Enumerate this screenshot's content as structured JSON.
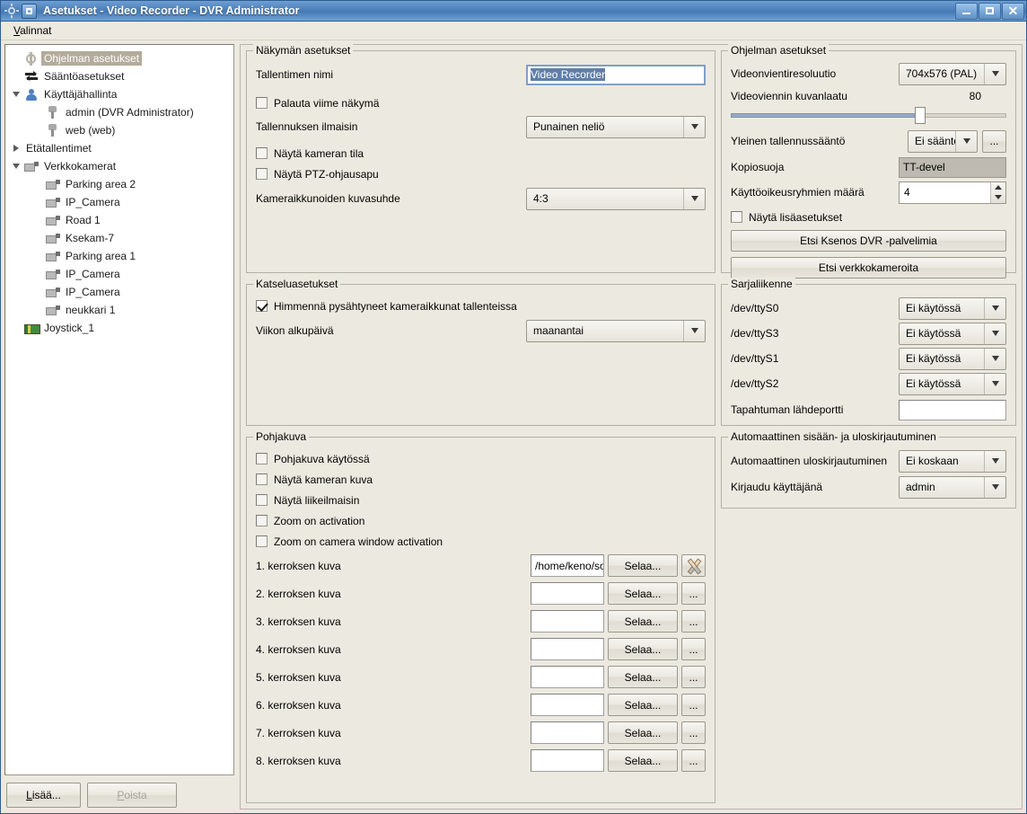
{
  "window": {
    "title": "Asetukset - Video Recorder - DVR Administrator",
    "minimize_label": "_",
    "maximize_label": "□",
    "close_label": "✕"
  },
  "menubar": {
    "items": [
      {
        "label": "Valinnat",
        "mnemonic": "V"
      }
    ]
  },
  "tree": {
    "items": [
      {
        "label": "Ohjelman asetukset",
        "icon": "gear-icon",
        "indent": 1,
        "selected": true,
        "twisty": "none"
      },
      {
        "label": "Sääntöasetukset",
        "icon": "rules-icon",
        "indent": 1,
        "selected": false,
        "twisty": "none"
      },
      {
        "label": "Käyttäjähallinta",
        "icon": "user-icon",
        "indent": 1,
        "selected": false,
        "twisty": "down"
      },
      {
        "label": "admin (DVR Administrator)",
        "icon": "key-icon",
        "indent": 2,
        "selected": false,
        "twisty": "none"
      },
      {
        "label": "web (web)",
        "icon": "key-icon",
        "indent": 2,
        "selected": false,
        "twisty": "none"
      },
      {
        "label": "Etätallentimet",
        "icon": "none",
        "indent": 1,
        "selected": false,
        "twisty": "right"
      },
      {
        "label": "Verkkokamerat",
        "icon": "camera-icon",
        "indent": 1,
        "selected": false,
        "twisty": "down"
      },
      {
        "label": "Parking area 2",
        "icon": "camera-icon",
        "indent": 2,
        "selected": false,
        "twisty": "none"
      },
      {
        "label": "IP_Camera",
        "icon": "camera-icon",
        "indent": 2,
        "selected": false,
        "twisty": "none"
      },
      {
        "label": "Road 1",
        "icon": "camera-icon",
        "indent": 2,
        "selected": false,
        "twisty": "none"
      },
      {
        "label": "Ksekam-7",
        "icon": "camera-icon",
        "indent": 2,
        "selected": false,
        "twisty": "none"
      },
      {
        "label": "Parking area 1",
        "icon": "camera-icon",
        "indent": 2,
        "selected": false,
        "twisty": "none"
      },
      {
        "label": "IP_Camera",
        "icon": "camera-icon",
        "indent": 2,
        "selected": false,
        "twisty": "none"
      },
      {
        "label": "IP_Camera",
        "icon": "camera-icon",
        "indent": 2,
        "selected": false,
        "twisty": "none"
      },
      {
        "label": "neukkari 1",
        "icon": "camera-icon",
        "indent": 2,
        "selected": false,
        "twisty": "none"
      },
      {
        "label": "Joystick_1",
        "icon": "joystick-icon",
        "indent": 1,
        "selected": false,
        "twisty": "none"
      }
    ],
    "add_button": {
      "label": "Lisää...",
      "mnemonic": "L",
      "enabled": true
    },
    "delete_button": {
      "label": "Poista",
      "mnemonic": "P",
      "enabled": false
    }
  },
  "view_settings": {
    "title": "Näkymän asetukset",
    "recorder_name_label": "Tallentimen nimi",
    "recorder_name_value": "Video Recorder",
    "restore_last_view_label": "Palauta viime näkymä",
    "restore_last_view_checked": false,
    "recording_indicator_label": "Tallennuksen ilmaisin",
    "recording_indicator_value": "Punainen neliö",
    "show_camera_state_label": "Näytä kameran tila",
    "show_camera_state_checked": false,
    "show_ptz_help_label": "Näytä PTZ-ohjausapu",
    "show_ptz_help_checked": false,
    "aspect_ratio_label": "Kameraikkunoiden kuvasuhde",
    "aspect_ratio_value": "4:3"
  },
  "program_settings": {
    "title": "Ohjelman asetukset",
    "export_resolution_label": "Videonvientiresoluutio",
    "export_resolution_value": "704x576 (PAL)",
    "export_quality_label": "Videoviennin kuvanlaatu",
    "export_quality_value": "80",
    "export_quality_percent": 80,
    "general_rule_label": "Yleinen tallennussääntö",
    "general_rule_value": "Ei sääntöä",
    "general_rule_more": "...",
    "copy_protection_label": "Kopiosuoja",
    "copy_protection_value": "TT-devel",
    "permission_groups_label": "Käyttöoikeusryhmien määrä",
    "permission_groups_value": "4",
    "show_advanced_label": "Näytä lisäasetukset",
    "show_advanced_checked": false,
    "find_servers_button": "Etsi Ksenos DVR -palvelimia",
    "find_cameras_button": "Etsi verkkokameroita"
  },
  "viewing_settings": {
    "title": "Katseluasetukset",
    "dim_stopped_label": "Himmennä pysähtyneet kameraikkunat tallenteissa",
    "dim_stopped_checked": true,
    "week_start_label": "Viikon alkupäivä",
    "week_start_value": "maanantai"
  },
  "serial": {
    "title": "Sarjaliikenne",
    "ports": [
      {
        "label": "/dev/ttyS0",
        "value": "Ei käytössä"
      },
      {
        "label": "/dev/ttyS3",
        "value": "Ei käytössä"
      },
      {
        "label": "/dev/ttyS1",
        "value": "Ei käytössä"
      },
      {
        "label": "/dev/ttyS2",
        "value": "Ei käytössä"
      }
    ],
    "event_source_label": "Tapahtuman lähdeportti",
    "event_source_value": ""
  },
  "floorplan": {
    "title": "Pohjakuva",
    "checkboxes": [
      {
        "label": "Pohjakuva käytössä",
        "checked": false
      },
      {
        "label": "Näytä kameran kuva",
        "checked": false
      },
      {
        "label": "Näytä liikeilmaisin",
        "checked": false
      },
      {
        "label": "Zoom on activation",
        "checked": false
      },
      {
        "label": "Zoom on camera window activation",
        "checked": false
      }
    ],
    "browse_label": "Selaa...",
    "dots_label": "...",
    "floors": [
      {
        "label": "1. kerroksen kuva",
        "value": "/home/keno/sot",
        "extra": "clear-icon"
      },
      {
        "label": "2. kerroksen kuva",
        "value": "",
        "extra": "dots"
      },
      {
        "label": "3. kerroksen kuva",
        "value": "",
        "extra": "dots"
      },
      {
        "label": "4. kerroksen kuva",
        "value": "",
        "extra": "dots"
      },
      {
        "label": "5. kerroksen kuva",
        "value": "",
        "extra": "dots"
      },
      {
        "label": "6. kerroksen kuva",
        "value": "",
        "extra": "dots"
      },
      {
        "label": "7. kerroksen kuva",
        "value": "",
        "extra": "dots"
      },
      {
        "label": "8. kerroksen kuva",
        "value": "",
        "extra": "dots"
      }
    ]
  },
  "autologin": {
    "title": "Automaattinen sisään- ja uloskirjautuminen",
    "auto_logout_label": "Automaattinen uloskirjautuminen",
    "auto_logout_value": "Ei koskaan",
    "login_as_label": "Kirjaudu käyttäjänä",
    "login_as_value": "admin"
  }
}
